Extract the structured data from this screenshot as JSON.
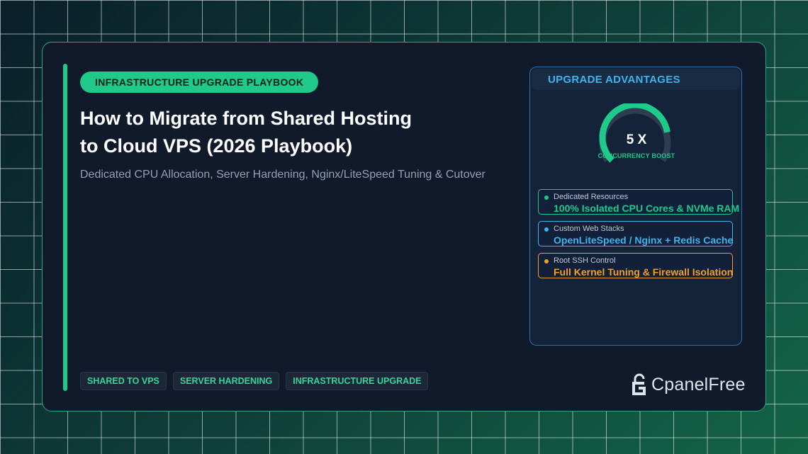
{
  "badge": "INFRASTRUCTURE UPGRADE PLAYBOOK",
  "title_line1": "How to Migrate from Shared Hosting",
  "title_line2": "to Cloud VPS (2026 Playbook)",
  "subtitle": "Dedicated CPU Allocation, Server Hardening, Nginx/LiteSpeed Tuning & Cutover",
  "tags": [
    "SHARED TO VPS",
    "SERVER HARDENING",
    "INFRASTRUCTURE UPGRADE"
  ],
  "panel": {
    "title": "UPGRADE ADVANTAGES",
    "gauge_value": "5 X",
    "gauge_caption": "CONCURRENCY BOOST",
    "gauge_fill": 0.8,
    "features": [
      {
        "label": "Dedicated Resources",
        "value": "100% Isolated CPU Cores & NVMe RAM",
        "color": "#1fc98a"
      },
      {
        "label": "Custom Web Stacks",
        "value": "OpenLiteSpeed / Nginx + Redis Cache",
        "color": "#3fb3ec"
      },
      {
        "label": "Root SSH Control",
        "value": "Full Kernel Tuning & Firewall Isolation",
        "color": "#f0a02a"
      }
    ]
  },
  "logo": {
    "text": "CpanelFree",
    "icon": "lock-icon"
  },
  "colors": {
    "accent": "#1fc98a",
    "blue": "#3fb3ec",
    "orange": "#f0a02a",
    "card_bg": "#101a2b"
  }
}
